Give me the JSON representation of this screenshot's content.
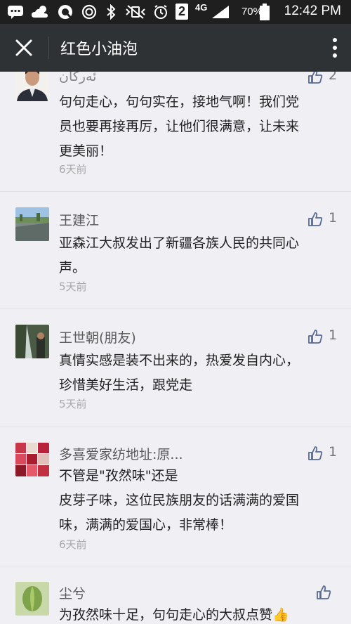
{
  "status_bar": {
    "battery_percent": "70%",
    "time": "12:42 PM",
    "network": "4G",
    "sim_slot": "2"
  },
  "nav": {
    "title": "红色小油泡"
  },
  "comments": [
    {
      "name": "ئەركان",
      "likes": "2",
      "lines": [
        "句句走心，句句实在，接地气啊！我们党",
        "员也要再接再厉，让他们很满意，让未来",
        "更美丽！"
      ],
      "time": "6天前"
    },
    {
      "name": "王建江",
      "likes": "1",
      "lines": [
        "亚森江大叔发出了新疆各族人民的共同心",
        "声。"
      ],
      "time": "5天前"
    },
    {
      "name": "王世朝(朋友)",
      "likes": "1",
      "lines": [
        "真情实感是装不出来的，热爱发自内心，",
        "珍惜美好生活，跟党走"
      ],
      "time": "5天前"
    },
    {
      "name": "多喜爱家纺地址:原...",
      "likes": "1",
      "lines": [
        "不管是\"孜然味\"还是",
        "皮芽子味，这位民族朋友的话满满的爱国",
        "味，满满的爱国心，非常棒！"
      ],
      "time": "6天前"
    },
    {
      "name": "尘兮",
      "likes": "",
      "lines": [
        "为孜然味十足，句句走心的大叔点赞👍"
      ],
      "time": ""
    }
  ],
  "colors": {
    "status_bar": "#1f1f1f",
    "nav_bar": "#2e3235",
    "background": "#efeff4",
    "like_icon": "#576b95"
  }
}
